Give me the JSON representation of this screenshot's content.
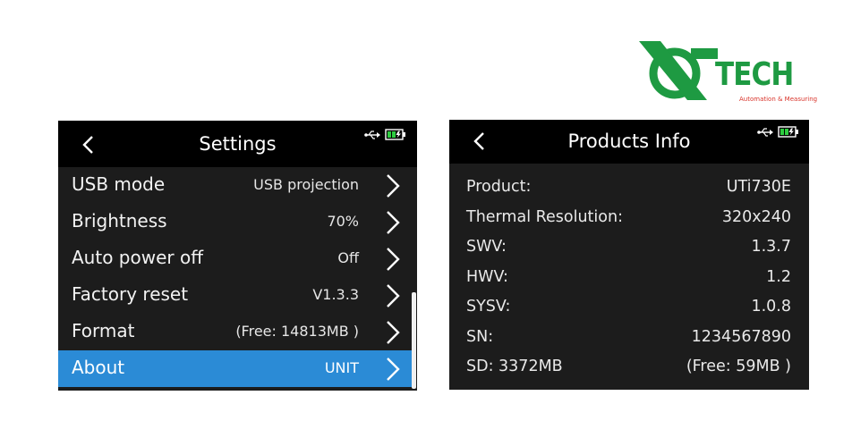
{
  "brand": {
    "name": "TECH",
    "tagline": "Automation & Measuring",
    "green": "#1e9a42",
    "red": "#d9342b"
  },
  "settings_screen": {
    "title": "Settings",
    "back_icon": "chevron-left-icon",
    "status_icons": [
      "usb-icon",
      "battery-charging-icon"
    ],
    "selected_color": "#2b8bd6",
    "items": [
      {
        "label": "USB mode",
        "value": "USB projection",
        "selected": false
      },
      {
        "label": "Brightness",
        "value": "70%",
        "selected": false
      },
      {
        "label": "Auto power off",
        "value": "Off",
        "selected": false
      },
      {
        "label": "Factory reset",
        "value": "V1.3.3",
        "selected": false
      },
      {
        "label": "Format",
        "value": "(Free: 14813MB )",
        "selected": false
      },
      {
        "label": "About",
        "value": "UNIT",
        "selected": true
      }
    ]
  },
  "products_screen": {
    "title": "Products Info",
    "back_icon": "chevron-left-icon",
    "status_icons": [
      "usb-icon",
      "battery-charging-icon"
    ],
    "rows": [
      {
        "key": "Product:",
        "value": "UTi730E"
      },
      {
        "key": "Thermal Resolution:",
        "value": "320x240"
      },
      {
        "key": "SWV:",
        "value": "1.3.7"
      },
      {
        "key": "HWV:",
        "value": "1.2"
      },
      {
        "key": "SYSV:",
        "value": "1.0.8"
      },
      {
        "key": "SN:",
        "value": "1234567890"
      },
      {
        "key": "SD: 3372MB",
        "value": "(Free: 59MB )"
      }
    ]
  }
}
